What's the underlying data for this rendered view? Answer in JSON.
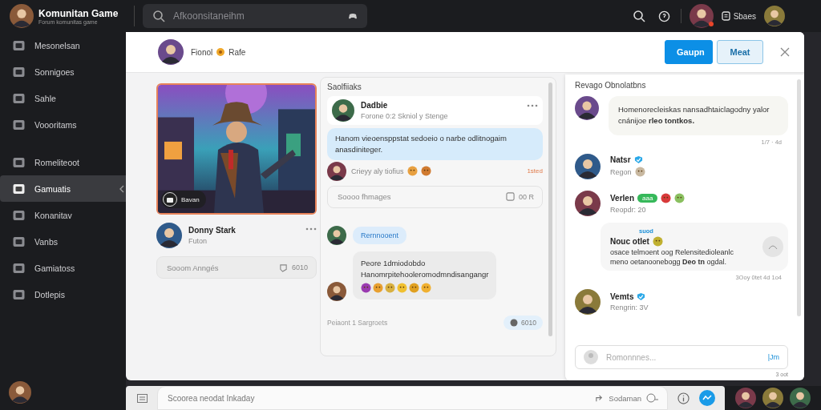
{
  "app": {
    "title": "Komunitan Game",
    "subtitle": "Forum komunitas game"
  },
  "search": {
    "placeholder": "Afkoonsitaneihm"
  },
  "top_actions": {
    "label": "Sbaes"
  },
  "sidebar": {
    "groups": [
      [
        {
          "label": "Mesonelsan",
          "selected": false
        },
        {
          "label": "Sonnigoes",
          "selected": false
        },
        {
          "label": "Sahle",
          "selected": false
        },
        {
          "label": "Voooritams",
          "selected": false
        }
      ],
      [
        {
          "label": "Romeliteoot",
          "selected": false
        },
        {
          "label": "Gamuatis",
          "selected": true
        },
        {
          "label": "Konanitav",
          "selected": false
        },
        {
          "label": "Vanbs",
          "selected": false
        },
        {
          "label": "Gamiatoss",
          "selected": false
        },
        {
          "label": "Dotlepis",
          "selected": false
        }
      ]
    ]
  },
  "dialog": {
    "user": "Fionol",
    "status": "Rafe",
    "buttons": [
      {
        "label": "Gaupn",
        "primary": true
      },
      {
        "label": "Meat",
        "primary": false
      }
    ]
  },
  "featured": {
    "badge": "Bavan",
    "author": "Donny Stark",
    "subtitle": "Futon",
    "comment_placeholder": "Sooom Anngés",
    "likes": "6010"
  },
  "thread": {
    "title": "Saolfiiaks",
    "post": {
      "author": "Dadbie",
      "meta": "Forone 0:2 Skniol y Stenge",
      "text": "Hanom vieoensppstat sedoeio o narbe odlitnogaim anasdiniteger.",
      "reaction_text": "Crieyy aly tiofius",
      "reaction_time": "1sted",
      "reply_placeholder": "Soooo fhmages",
      "reply_count": "00 R"
    },
    "chat": {
      "tag": "Rernnooent",
      "lines": [
        "Peore 1dmiodobdo",
        "Hanomrpitehooleromodmndisangangr"
      ],
      "footer": "Peiaont 1 Sargroets",
      "count": "6010"
    }
  },
  "comments": {
    "title": "Revago Obnolatbns",
    "first": {
      "text": "Homenorecleiskas nansadhtaiclagodny yalor cnánijoe **rleo tontkos.**",
      "time": "1/7 · 4d"
    },
    "users": [
      {
        "name": "Natsr",
        "verified": true,
        "sub": "Regon"
      },
      {
        "name": "Verlen",
        "verified": false,
        "badge": "aaa",
        "sub": "Reopdr: 20"
      }
    ],
    "reply": {
      "tag": "suod",
      "title": "Nouc otlet",
      "lines": [
        "osace telmoent oog Relensitedioleanlc",
        "meno oetanoonebogg **Deo tn** ogdal."
      ],
      "time": "3Ooy 0tet 4d 1o4"
    },
    "last_user": {
      "name": "Vemts",
      "verified": true,
      "sub": "Rengrin: 3V"
    },
    "input": {
      "placeholder": "Romonnnes...",
      "action": "|Jm"
    },
    "footnote": "3 oot"
  },
  "composer": {
    "placeholder": "Scoorea neodat Inkaday",
    "label": "Sodaman"
  }
}
